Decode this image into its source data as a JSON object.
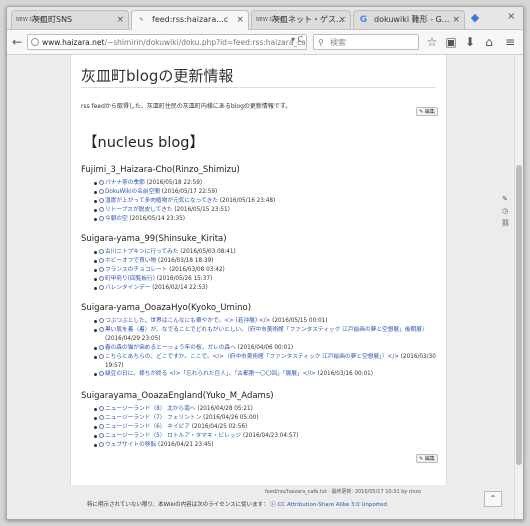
{
  "tabs": [
    {
      "favicon": "NEW GAME",
      "label": "灰皿町SNS"
    },
    {
      "favicon": "dokuwiki",
      "label": "feed:rss:haizara...c"
    },
    {
      "favicon": "NEW GAME",
      "label": "灰皿ネット・ゲス..."
    },
    {
      "favicon": "G",
      "label": "dokuwiki 難形 - G..."
    }
  ],
  "url": {
    "host": "www.haizara.net",
    "path": "/~shimirin/dokuwiki/doku.php?id=feed:rss:haizara_cafe"
  },
  "search_placeholder": "検索",
  "page": {
    "title": "灰皿町blogの更新情報",
    "intro": "rss feedから取得した、灰皿町住民の灰皿町内様にあるblogの更新情報です。",
    "edit_label": "編集",
    "blog_title": "【nucleus blog】",
    "sections": [
      {
        "heading": "Fujimi_3_Haizara-Cho(Rinzo_Shimizu)",
        "items": [
          {
            "link": "パナナ茶の季節",
            "date": " (2016/05/18 22:59)"
          },
          {
            "link": "DokuWikiの名前空間",
            "date": " (2016/05/17 22:59)"
          },
          {
            "link": "湿度が上がって多肉植物が元気になってきた",
            "date": " (2016/05/16 23:48)"
          },
          {
            "link": "リトープスが脱皮してきた",
            "date": " (2016/05/15 23:51)"
          },
          {
            "link": "今朝の空",
            "date": " (2016/05/14 23:35)"
          }
        ]
      },
      {
        "heading": "Suigara-yama_99(Shinsuke_Kirita)",
        "items": [
          {
            "link": "古川ニトプキンに行ってみた",
            "date": " (2016/05/03 08:41)"
          },
          {
            "link": "ホビーオフで買い物",
            "date": " (2016/03/18 18:39)"
          },
          {
            "link": "フランスのチョコレート",
            "date": " (2016/03/08 03:42)"
          },
          {
            "link": "町甲府り(回覧板行)",
            "date": " (2016/05/26 15:37)"
          },
          {
            "link": "バレンタインデー",
            "date": " (2016/02/14 22:53)"
          }
        ]
      },
      {
        "heading": "Suigara-yama_OoazaHyo(Kyoko_Umino)",
        "items": [
          {
            "link": "つぶつぶとした、世界はこんなにも華やかで。<> (若沖展) </>",
            "date": " (2016/05/15 00:01)"
          },
          {
            "link": "黒い股を着（着）が、なでることでどれもがいとしい。（府中市美術館「ファンタスティック 江戸絵画の夢と空想展」後期展）",
            "date": " (2016/04/29 23:05)"
          },
          {
            "link": "春の森の猫が染めると一っょう年の桜。ガレの森へ",
            "date": " (2016/04/06 00:01)"
          },
          {
            "link": "こちらとあちらの、どこですか。ここで。</>（府中市美術館「ファンタスティック 江戸絵画の夢と空想展」）</>",
            "date": " (2016/03/30 19:57)"
          },
          {
            "link": "緑豆の日に、様ちが終る <I>「忘れられた巨人」、「古都第一〇〇回」「展展」</I>",
            "date": " (2016/03/16 00:01)"
          }
        ]
      },
      {
        "heading": "Suigarayama_OoazaEngland(Yuko_M_Adams)",
        "items": [
          {
            "link": "ニュージーランド（8） 北から南へ",
            "date": " (2016/04/28 05:21)"
          },
          {
            "link": "ニュージーランド（7） フェリントン",
            "date": " (2016/04/26 05:00)"
          },
          {
            "link": "ニュージーランド（6） ネイピア",
            "date": " (2016/04/25 02:56)"
          },
          {
            "link": "ニュージーランド（5） ロトルア・タマキ・ビレッジ",
            "date": " (2016/04/23 04:57)"
          },
          {
            "link": "ウェブサイトの移転",
            "date": " (2016/04/21 23:45)"
          }
        ]
      }
    ],
    "footer_meta": "feed/rss/haizara_cafe.txt · 最終更新: 2016/05/17 10:31 by rinzo",
    "license_prefix": "特に明示されていない限り、本Wikiの内容は次のライセンスに従います：",
    "license_link": "CC Attribution-Share Alike 3.0 Unported"
  },
  "icons": {
    "back": "back-arrow-icon",
    "bookmark": "star-icon",
    "home": "home-icon",
    "menu": "menu-icon"
  }
}
